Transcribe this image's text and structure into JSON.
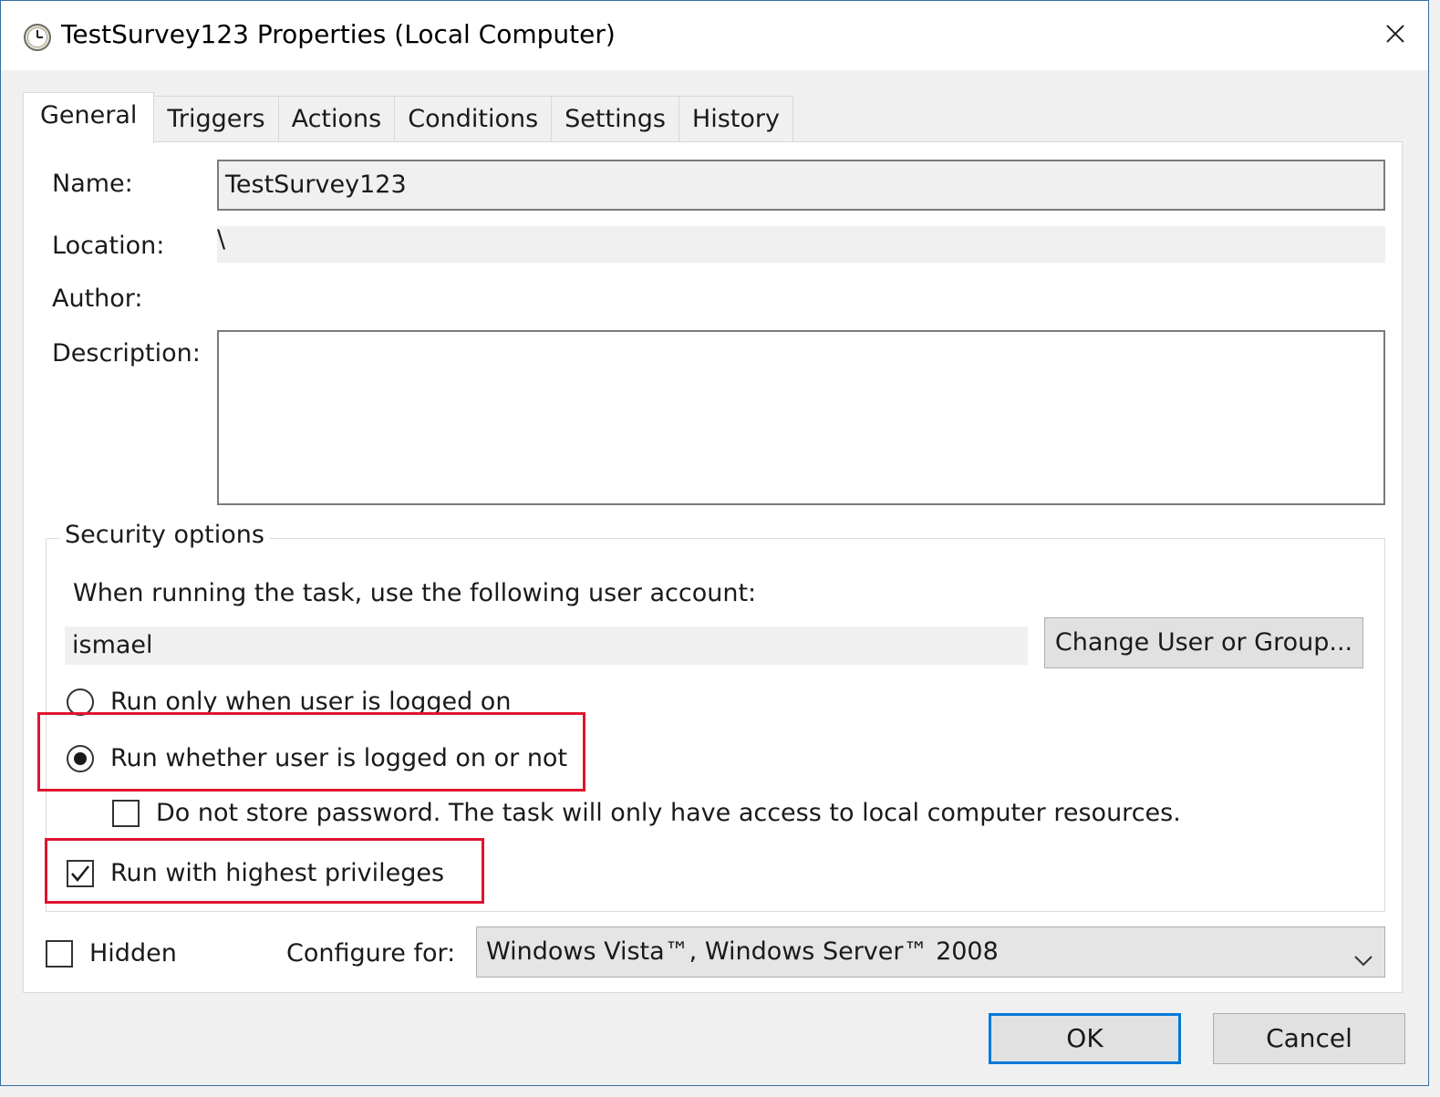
{
  "window": {
    "title": "TestSurvey123 Properties (Local Computer)",
    "icon": "clock-icon",
    "close_icon": "close-icon"
  },
  "tabs": [
    {
      "label": "General",
      "active": true
    },
    {
      "label": "Triggers",
      "active": false
    },
    {
      "label": "Actions",
      "active": false
    },
    {
      "label": "Conditions",
      "active": false
    },
    {
      "label": "Settings",
      "active": false
    },
    {
      "label": "History",
      "active": false
    }
  ],
  "general": {
    "name_label": "Name:",
    "name_value": "TestSurvey123",
    "location_label": "Location:",
    "location_value": "\\",
    "author_label": "Author:",
    "author_value": "",
    "description_label": "Description:",
    "description_value": ""
  },
  "security": {
    "legend": "Security options",
    "account_prompt": "When running the task, use the following user account:",
    "account_value": "ismael",
    "change_user_label": "Change User or Group...",
    "run_only_logged_on_label": "Run only when user is logged on",
    "run_whether_logged_on_label": "Run whether user is logged on or not",
    "do_not_store_password_label": "Do not store password.  The task will only have access to local computer resources.",
    "run_highest_privileges_label": "Run with highest privileges",
    "selected_run_mode": "run_whether_logged_on",
    "do_not_store_password_checked": false,
    "run_highest_privileges_checked": true
  },
  "bottom": {
    "hidden_label": "Hidden",
    "hidden_checked": false,
    "configure_for_label": "Configure for:",
    "configure_for_value": "Windows Vista™, Windows Server™ 2008"
  },
  "buttons": {
    "ok_label": "OK",
    "cancel_label": "Cancel"
  },
  "colors": {
    "highlight": "#e0142e",
    "default_button_border": "#0078d7",
    "window_border": "#3a6ea5"
  }
}
